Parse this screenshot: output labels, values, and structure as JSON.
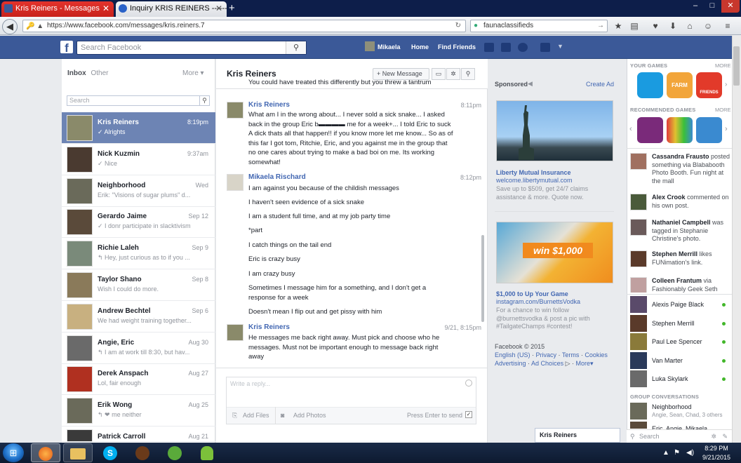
{
  "browser": {
    "tabs": [
      {
        "title": "Kris Reiners - Messages",
        "active": true
      },
      {
        "title": "Inquiry KRIS REINERS -------..."
      }
    ],
    "new_tab": "+",
    "url": "https://www.facebook.com/messages/kris.reiners.7",
    "search_value": "faunaclassifieds",
    "window_controls": [
      "–",
      "□",
      "✕"
    ]
  },
  "fb_header": {
    "search_placeholder": "Search Facebook",
    "user_name": "Mikaela",
    "home": "Home",
    "find_friends": "Find Friends"
  },
  "inbox": {
    "tab_inbox": "Inbox",
    "tab_other": "Other",
    "more": "More ▾",
    "search_placeholder": "Search",
    "conversations": [
      {
        "name": "Kris Reiners",
        "preview": "✓ Alrights",
        "time": "8:19pm",
        "selected": true,
        "color": "#8a8a6a"
      },
      {
        "name": "Nick Kuzmin",
        "preview": "✓ Nice",
        "time": "9:37am",
        "color": "#4a3a30"
      },
      {
        "name": "Neighborhood",
        "preview": "Erik: \"Visions of sugar plums\" d...",
        "time": "Wed",
        "color": "#6a6a5a"
      },
      {
        "name": "Gerardo Jaime",
        "preview": "✓ I donr participate in slacktivism",
        "time": "Sep 12",
        "color": "#5a4a3a"
      },
      {
        "name": "Richie Laleh",
        "preview": "↰ Hey, just curious as to if you ...",
        "time": "Sep 9",
        "color": "#7a8a7a"
      },
      {
        "name": "Taylor Shano",
        "preview": "Wish I could do more.",
        "time": "Sep 8",
        "color": "#8a7a5a"
      },
      {
        "name": "Andrew Bechtel",
        "preview": "We had weight training together...",
        "time": "Sep 6",
        "color": "#c8b080"
      },
      {
        "name": "Angie, Eric",
        "preview": "↰ I am at work till 8:30, but hav...",
        "time": "Aug 30",
        "color": "#6a6a6a"
      },
      {
        "name": "Derek Anspach",
        "preview": "Lol, fair enough",
        "time": "Aug 27",
        "color": "#b03020"
      },
      {
        "name": "Erik Wong",
        "preview": "↰ ❤ me neither",
        "time": "Aug 25",
        "color": "#6a6a5a"
      },
      {
        "name": "Patrick Carroll",
        "preview": "",
        "time": "Aug 21",
        "color": "#3a3a3a"
      }
    ]
  },
  "conversation": {
    "title": "Kris Reiners",
    "new_message": "+ New Message",
    "cut_off_text": "You could have treated this differently but you threw a tantrum",
    "messages": [
      {
        "sender": "Kris Reiners",
        "time": "8:11pm",
        "text": "What am I in the wrong about... I never sold a sick snake... I asked back in the group Eric b▬▬▬▬ me for a week+... I told Eric to suck A dick thats all that happen!! if you know more let me know... So as of this far I got tom, Ritchie, Eric, and you against me in the group that no one cares about trying to make a bad boi on me. Its working somewhat!"
      },
      {
        "sender": "Mikaela Rischard",
        "time": "8:12pm",
        "lines": [
          "I am against you because of the childish messages",
          "I haven't seen evidence of a sick snake",
          "I am a student full time, and at my job party time",
          "*part",
          "I catch things on the tail end",
          "Eric is crazy busy",
          "I am crazy busy",
          "Sometimes I message him for a something, and I don't get a response for a week",
          "Doesn't mean I flip out and get pissy with him"
        ]
      },
      {
        "sender": "Kris Reiners",
        "time": "9/21, 8:15pm",
        "text": "He messages me back right away. Must pick and choose who he messages. Must not be important enough to message back right away"
      }
    ],
    "reply_placeholder": "Write a reply...",
    "add_files": "Add Files",
    "add_photos": "Add Photos",
    "press_enter": "Press Enter to send"
  },
  "ads": {
    "sponsored": "Sponsored",
    "create_ad": "Create Ad",
    "items": [
      {
        "title": "Liberty Mutual Insurance",
        "url": "welcome.libertymutual.com",
        "text": "Save up to $509, get 24/7 claims assistance & more. Quote now."
      },
      {
        "title": "$1,000 to Up Your Game",
        "url": "instagram.com/BurnettsVodka",
        "text": "For a chance to win follow @burnettsvodka & post a pic with #TailgateChamps #contest!",
        "banner": "win $1,000"
      }
    ],
    "footer": {
      "copyright": "Facebook © 2015",
      "links1": [
        "English (US)",
        "Privacy",
        "Terms",
        "Cookies"
      ],
      "links2": [
        "Advertising",
        "Ad Choices",
        "More"
      ]
    }
  },
  "sidebar": {
    "your_games": "YOUR GAMES",
    "more": "MORE",
    "games": [
      {
        "label": "",
        "color": "#1a9be0"
      },
      {
        "label": "FARM TOWN",
        "color": "#f2a53a"
      },
      {
        "label": "FRIENDS",
        "color": "#e23a2a"
      }
    ],
    "recommended_games": "RECOMMENDED GAMES",
    "rec_games": [
      {
        "color": "#7a2a7a"
      },
      {
        "color": "#e0c030"
      },
      {
        "color": "#3a8ad0"
      }
    ],
    "ticker": [
      {
        "name": "Cassandra Frausto",
        "text": " posted something via Blababooth Photo Booth. Fun night at the mall",
        "color": "#a07060"
      },
      {
        "name": "Alex Crook",
        "text": " commented on his own post.",
        "color": "#4a5a3a"
      },
      {
        "name": "Nathaniel Campbell",
        "text": " was tagged in Stephanie Christine's photo.",
        "color": "#6a5a5a"
      },
      {
        "name": "Stephen Merrill",
        "text": " likes FUNimation's link.",
        "color": "#5a3a2a"
      },
      {
        "name": "Colleen Frantum",
        "text": " via Fashionably Geek Seth",
        "color": "#c0a0a0"
      }
    ],
    "chat": [
      {
        "name": "Alexis Paige Black",
        "online": true,
        "color": "#5a4a6a"
      },
      {
        "name": "Stephen Merrill",
        "online": true,
        "color": "#5a3a2a"
      },
      {
        "name": "Paul Lee Spencer",
        "online": true,
        "color": "#8a7a3a"
      },
      {
        "name": "Van Marter",
        "online": true,
        "color": "#2a3a5a"
      },
      {
        "name": "Luka Skylark",
        "online": true,
        "color": "#6a6a6a"
      }
    ],
    "group_conversations": "GROUP CONVERSATIONS",
    "groups": [
      {
        "name": "Neighborhood",
        "members": "Angie, Sean, Chad, 3 others"
      },
      {
        "name": "Eric, Angie, Mikaela"
      }
    ],
    "search_placeholder": "Search"
  },
  "chat_tab": "Kris Reiners",
  "taskbar": {
    "time": "8:29 PM",
    "date": "9/21/2015"
  }
}
